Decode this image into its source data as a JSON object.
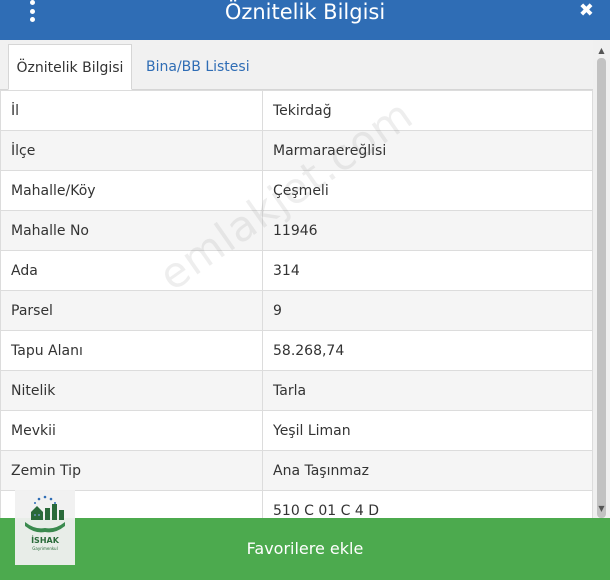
{
  "header": {
    "title": "Öznitelik Bilgisi",
    "menu_icon": "kebab-menu-icon",
    "close_icon": "close-icon",
    "close_glyph": "✖"
  },
  "tabs": [
    {
      "label": "Öznitelik Bilgisi",
      "active": true
    },
    {
      "label": "Bina/BB Listesi",
      "active": false
    }
  ],
  "rows": [
    {
      "key": "İl",
      "value": "Tekirdağ"
    },
    {
      "key": "İlçe",
      "value": "Marmaraereğlisi"
    },
    {
      "key": "Mahalle/Köy",
      "value": "Çeşmeli"
    },
    {
      "key": "Mahalle No",
      "value": "11946"
    },
    {
      "key": "Ada",
      "value": "314"
    },
    {
      "key": "Parsel",
      "value": "9"
    },
    {
      "key": "Tapu Alanı",
      "value": "58.268,74"
    },
    {
      "key": "Nitelik",
      "value": "Tarla"
    },
    {
      "key": "Mevkii",
      "value": "Yeşil Liman"
    },
    {
      "key": "Zemin Tip",
      "value": "Ana Taşınmaz"
    },
    {
      "key": "",
      "value": "510 C 01 C 4 D"
    }
  ],
  "watermark": "emlakjet.com",
  "footer": {
    "button_label": "Favorilere ekle"
  },
  "logo": {
    "brand": "İSHAK",
    "tagline": "Gayrimenkul"
  },
  "colors": {
    "header": "#2f6db5",
    "tab_link": "#2f6db5",
    "footer_button": "#4caa4e"
  }
}
